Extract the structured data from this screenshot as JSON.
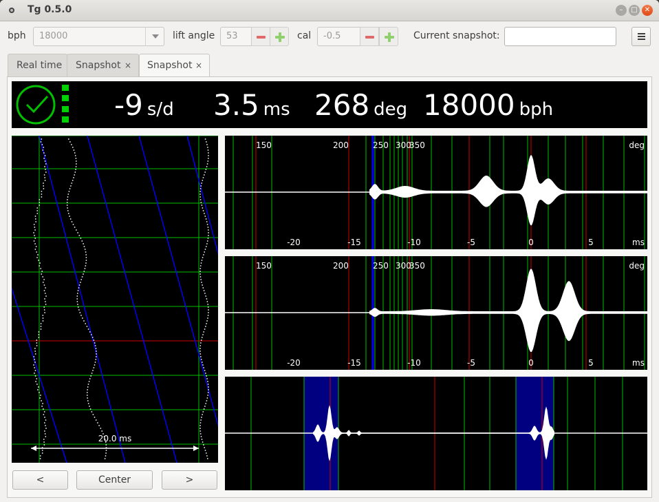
{
  "window": {
    "title": "Tg 0.5.0"
  },
  "toolbar": {
    "bph_label": "bph",
    "bph_value": "18000",
    "lift_angle_label": "lift angle",
    "lift_angle_value": "53",
    "cal_label": "cal",
    "cal_value": "-0.5",
    "snapshot_label": "Current snapshot:",
    "snapshot_value": ""
  },
  "tabs": [
    {
      "label": "Real time",
      "closable": false,
      "active": false
    },
    {
      "label": "Snapshot",
      "closable": true,
      "active": false
    },
    {
      "label": "Snapshot",
      "closable": true,
      "active": true
    }
  ],
  "tab_close_glyph": "×",
  "status": {
    "rate_value": "-9",
    "rate_unit": "s/d",
    "beat_error_value": "3.5",
    "beat_error_unit": "ms",
    "amplitude_value": "268",
    "amplitude_unit": "deg",
    "bph_value": "18000",
    "bph_unit": "bph",
    "icon": "clock-ok-icon",
    "color": "#00c000"
  },
  "paperstrip": {
    "scale_label": "20.0 ms"
  },
  "buttons": {
    "prev": "<",
    "center": "Center",
    "next": ">"
  },
  "waveform_axes": {
    "deg_ticks": [
      "150",
      "200",
      "250",
      "300",
      "350"
    ],
    "deg_unit": "deg",
    "ms_ticks": [
      "-20",
      "-15",
      "-10",
      "-5",
      "0",
      "5"
    ],
    "ms_unit": "ms"
  },
  "colors": {
    "grid_green": "#00c000",
    "grid_red": "#d00000",
    "trace_blue": "#0000ff",
    "highlight_blue": "#000080"
  }
}
